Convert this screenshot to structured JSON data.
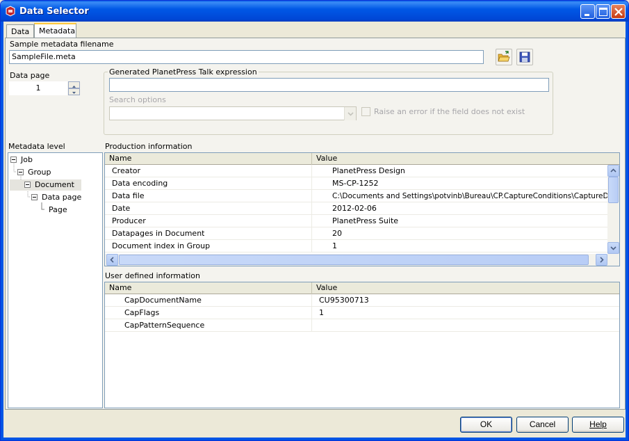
{
  "window": {
    "title": "Data Selector"
  },
  "tabs": [
    {
      "label": "Data"
    },
    {
      "label": "Metadata"
    }
  ],
  "metadata_file": {
    "label": "Sample metadata filename",
    "value": "SampleFile.meta"
  },
  "data_page": {
    "label": "Data page",
    "value": "1"
  },
  "expression": {
    "group_label": "Generated PlanetPress Talk expression",
    "value": "",
    "search_label": "Search options",
    "search_value": "",
    "error_checkbox_label": "Raise an error if the field does not exist"
  },
  "metadata_level": {
    "label": "Metadata level",
    "items": [
      {
        "label": "Job"
      },
      {
        "label": "Group"
      },
      {
        "label": "Document"
      },
      {
        "label": "Data page"
      },
      {
        "label": "Page"
      }
    ]
  },
  "production": {
    "label": "Production information",
    "columns": [
      "Name",
      "Value"
    ],
    "rows": [
      {
        "name": "Creator",
        "value": "PlanetPress Design"
      },
      {
        "name": "Data encoding",
        "value": "MS-CP-1252"
      },
      {
        "name": "Data file",
        "value": "C:\\Documents and Settings\\potvinb\\Bureau\\CP.CaptureConditions\\CaptureDemo.D"
      },
      {
        "name": "Date",
        "value": "2012-02-06"
      },
      {
        "name": "Producer",
        "value": "PlanetPress Suite"
      },
      {
        "name": "Datapages in Document",
        "value": "20"
      },
      {
        "name": "Document index in Group",
        "value": "1"
      }
    ]
  },
  "user_defined": {
    "label": "User defined information",
    "columns": [
      "Name",
      "Value"
    ],
    "rows": [
      {
        "name": "CapDocumentName",
        "value": "CU95300713"
      },
      {
        "name": "CapFlags",
        "value": "1"
      },
      {
        "name": "CapPatternSequence",
        "value": ""
      }
    ]
  },
  "buttons": {
    "ok": "OK",
    "cancel": "Cancel",
    "help": "Help"
  },
  "icons": {
    "app": "app-icon",
    "open": "folder-open-icon",
    "save": "floppy-disk-icon"
  }
}
